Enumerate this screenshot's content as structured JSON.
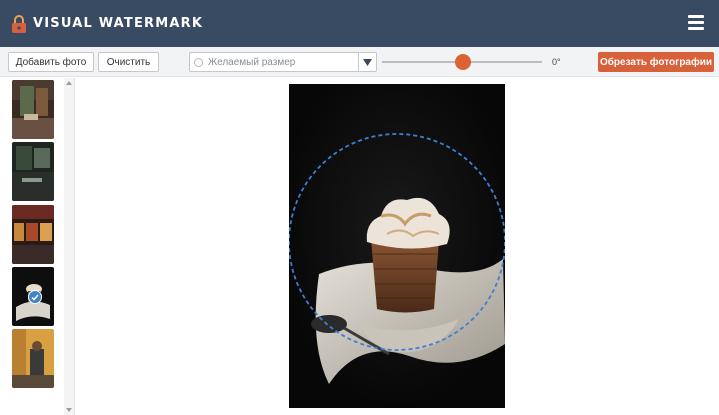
{
  "header": {
    "app_name": "VISUAL WATERMARK",
    "logo_icon": "padlock-icon",
    "menu_icon": "hamburger-menu-icon",
    "bg_color": "#394a63"
  },
  "toolbar": {
    "add_photo_label": "Добавить фото",
    "clear_label": "Очистить",
    "size_option_label": "Желаемый размер",
    "rotation_angle": "0°",
    "crop_button_label": "Обрезать фотографии",
    "accent_color": "#d8603a"
  },
  "sidebar": {
    "thumbnails": [
      {
        "name": "thumbnail-1",
        "selected": false
      },
      {
        "name": "thumbnail-2",
        "selected": false
      },
      {
        "name": "thumbnail-3",
        "selected": false
      },
      {
        "name": "thumbnail-4",
        "selected": true
      },
      {
        "name": "thumbnail-5",
        "selected": false
      }
    ]
  },
  "preview": {
    "subject": "cupcake with meringue on dark background",
    "crop_shape": "circle"
  }
}
